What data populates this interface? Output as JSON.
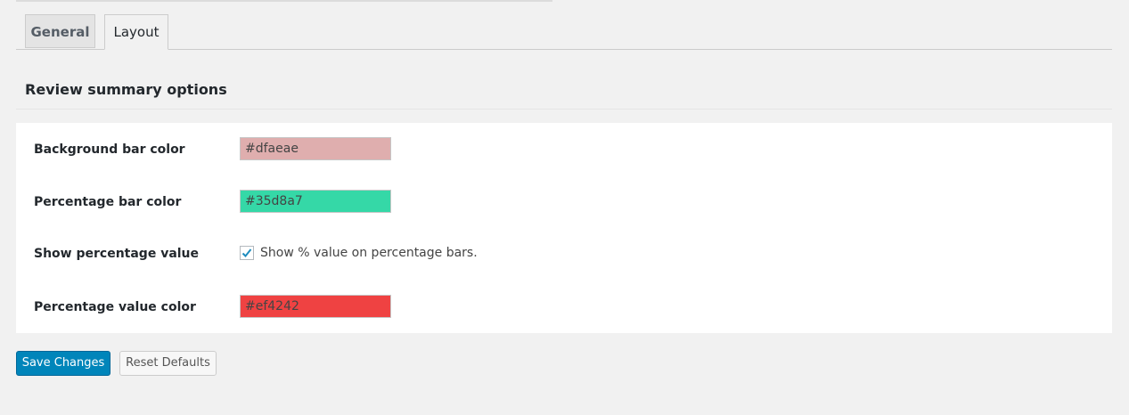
{
  "tabs": [
    {
      "label": "General",
      "active": false
    },
    {
      "label": "Layout",
      "active": true
    }
  ],
  "section": {
    "title": "Review summary options"
  },
  "options": {
    "background_bar": {
      "label": "Background bar color",
      "value": "#dfaeae",
      "color": "#dfaeae"
    },
    "percentage_bar": {
      "label": "Percentage bar color",
      "value": "#35d8a7",
      "color": "#35d8a7"
    },
    "show_percentage": {
      "label": "Show percentage value",
      "checkbox_label": "Show % value on percentage bars.",
      "checked": true
    },
    "percentage_value": {
      "label": "Percentage value color",
      "value": "#ef4242",
      "color": "#ef4242"
    }
  },
  "buttons": {
    "save": "Save Changes",
    "reset": "Reset Defaults"
  },
  "colors": {
    "primary_button": "#0085ba",
    "checkmark": "#1e8cbe"
  }
}
